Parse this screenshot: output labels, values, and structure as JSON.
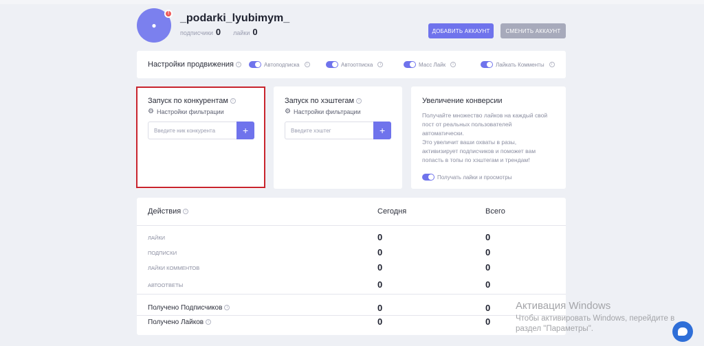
{
  "profile": {
    "username": "_podarki_lyubimym_",
    "badge": "!",
    "followers_label": "подписчики",
    "followers_count": "0",
    "likes_label": "лайки",
    "likes_count": "0",
    "add_account": "ДОБАВИТЬ АККАУНТ",
    "switch_account": "СМЕНИТЬ АККАУНТ"
  },
  "promo": {
    "title": "Настройки продвижения",
    "toggles": [
      {
        "label": "Автоподписка",
        "on": true
      },
      {
        "label": "Автоотписка",
        "on": true
      },
      {
        "label": "Масс Лайк",
        "on": true
      },
      {
        "label": "Лайкать Комменты",
        "on": true
      }
    ]
  },
  "competitors": {
    "title": "Запуск по конкурентам",
    "filter": "Настройки фильтрации",
    "placeholder": "Введите ник конкурента",
    "plus": "+"
  },
  "hashtags": {
    "title": "Запуск по хэштегам",
    "filter": "Настройки фильтрации",
    "placeholder": "Введите хэштег",
    "plus": "+"
  },
  "conversion": {
    "title": "Увеличение конверсии",
    "text_lines": [
      "Получайте множество лайков на каждый свой",
      "пост от реальных пользователей",
      "автоматически.",
      "Это увеличит ваши охваты в разы,",
      "активизирует подписчиков и поможет вам",
      "попасть в топы по хэштегам и трендам!"
    ],
    "toggle_label": "Получать лайки и просмотры"
  },
  "stats": {
    "col_actions": "Действия",
    "col_today": "Сегодня",
    "col_total": "Всего",
    "rows": [
      {
        "label": "ЛАЙКИ",
        "today": "0",
        "total": "0"
      },
      {
        "label": "ПОДПИСКИ",
        "today": "0",
        "total": "0"
      },
      {
        "label": "ЛАЙКИ КОММЕНТОВ",
        "today": "0",
        "total": "0"
      },
      {
        "label": "АВТООТВЕТЫ",
        "today": "0",
        "total": "0"
      }
    ],
    "summary": [
      {
        "label": "Получено Подписчиков",
        "today": "0",
        "total": "0"
      },
      {
        "label": "Получено Лайков",
        "today": "0",
        "total": "0"
      }
    ]
  },
  "watermark": {
    "title": "Активация Windows",
    "line1": "Чтобы активировать Windows, перейдите в",
    "line2": "раздел \"Параметры\"."
  },
  "colors": {
    "accent": "#6f73ec",
    "highlight_border": "#c8232c",
    "secondary_button": "#a7aabb"
  }
}
